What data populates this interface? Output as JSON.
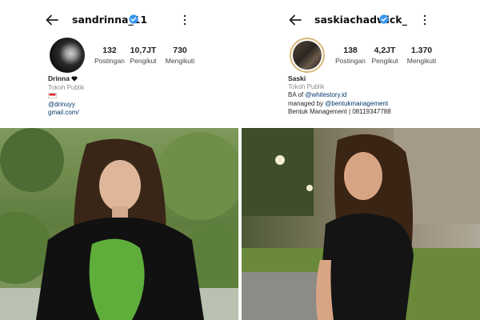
{
  "left_profile": {
    "username": "sandrinna_11",
    "stats": [
      {
        "value": "132",
        "label": "Postingan"
      },
      {
        "value": "10,7JT",
        "label": "Pengikut"
      },
      {
        "value": "730",
        "label": "Mengikuti"
      }
    ],
    "bio": {
      "name": "Drinna",
      "category": "Tokoh Publik",
      "line1": "@drinuyy",
      "line2": "gmail.com/"
    }
  },
  "right_profile": {
    "username": "saskiachadwick_",
    "stats": [
      {
        "value": "138",
        "label": "Postingan"
      },
      {
        "value": "4,2JT",
        "label": "Pengikut"
      },
      {
        "value": "1.370",
        "label": "Mengikuti"
      }
    ],
    "bio": {
      "name": "Saski",
      "category": "Tokoh Publik",
      "line1_prefix": "BA of ",
      "line1_link": "@whitestory.id",
      "line2_prefix": "managed by ",
      "line2_link": "@bentukmanagement",
      "line3": "Bentuk Management | 08119347788"
    }
  },
  "icons": {
    "back": "arrow-left-icon",
    "verified": "verified-badge-icon",
    "menu": "more-vertical-icon",
    "flag": "indonesia-flag-icon",
    "heart": "black-heart-icon"
  },
  "colors": {
    "verified_blue": "#3897f0",
    "link_blue": "#00376b",
    "text_dark": "#262626",
    "secondary_gray": "#8e8e8e"
  }
}
